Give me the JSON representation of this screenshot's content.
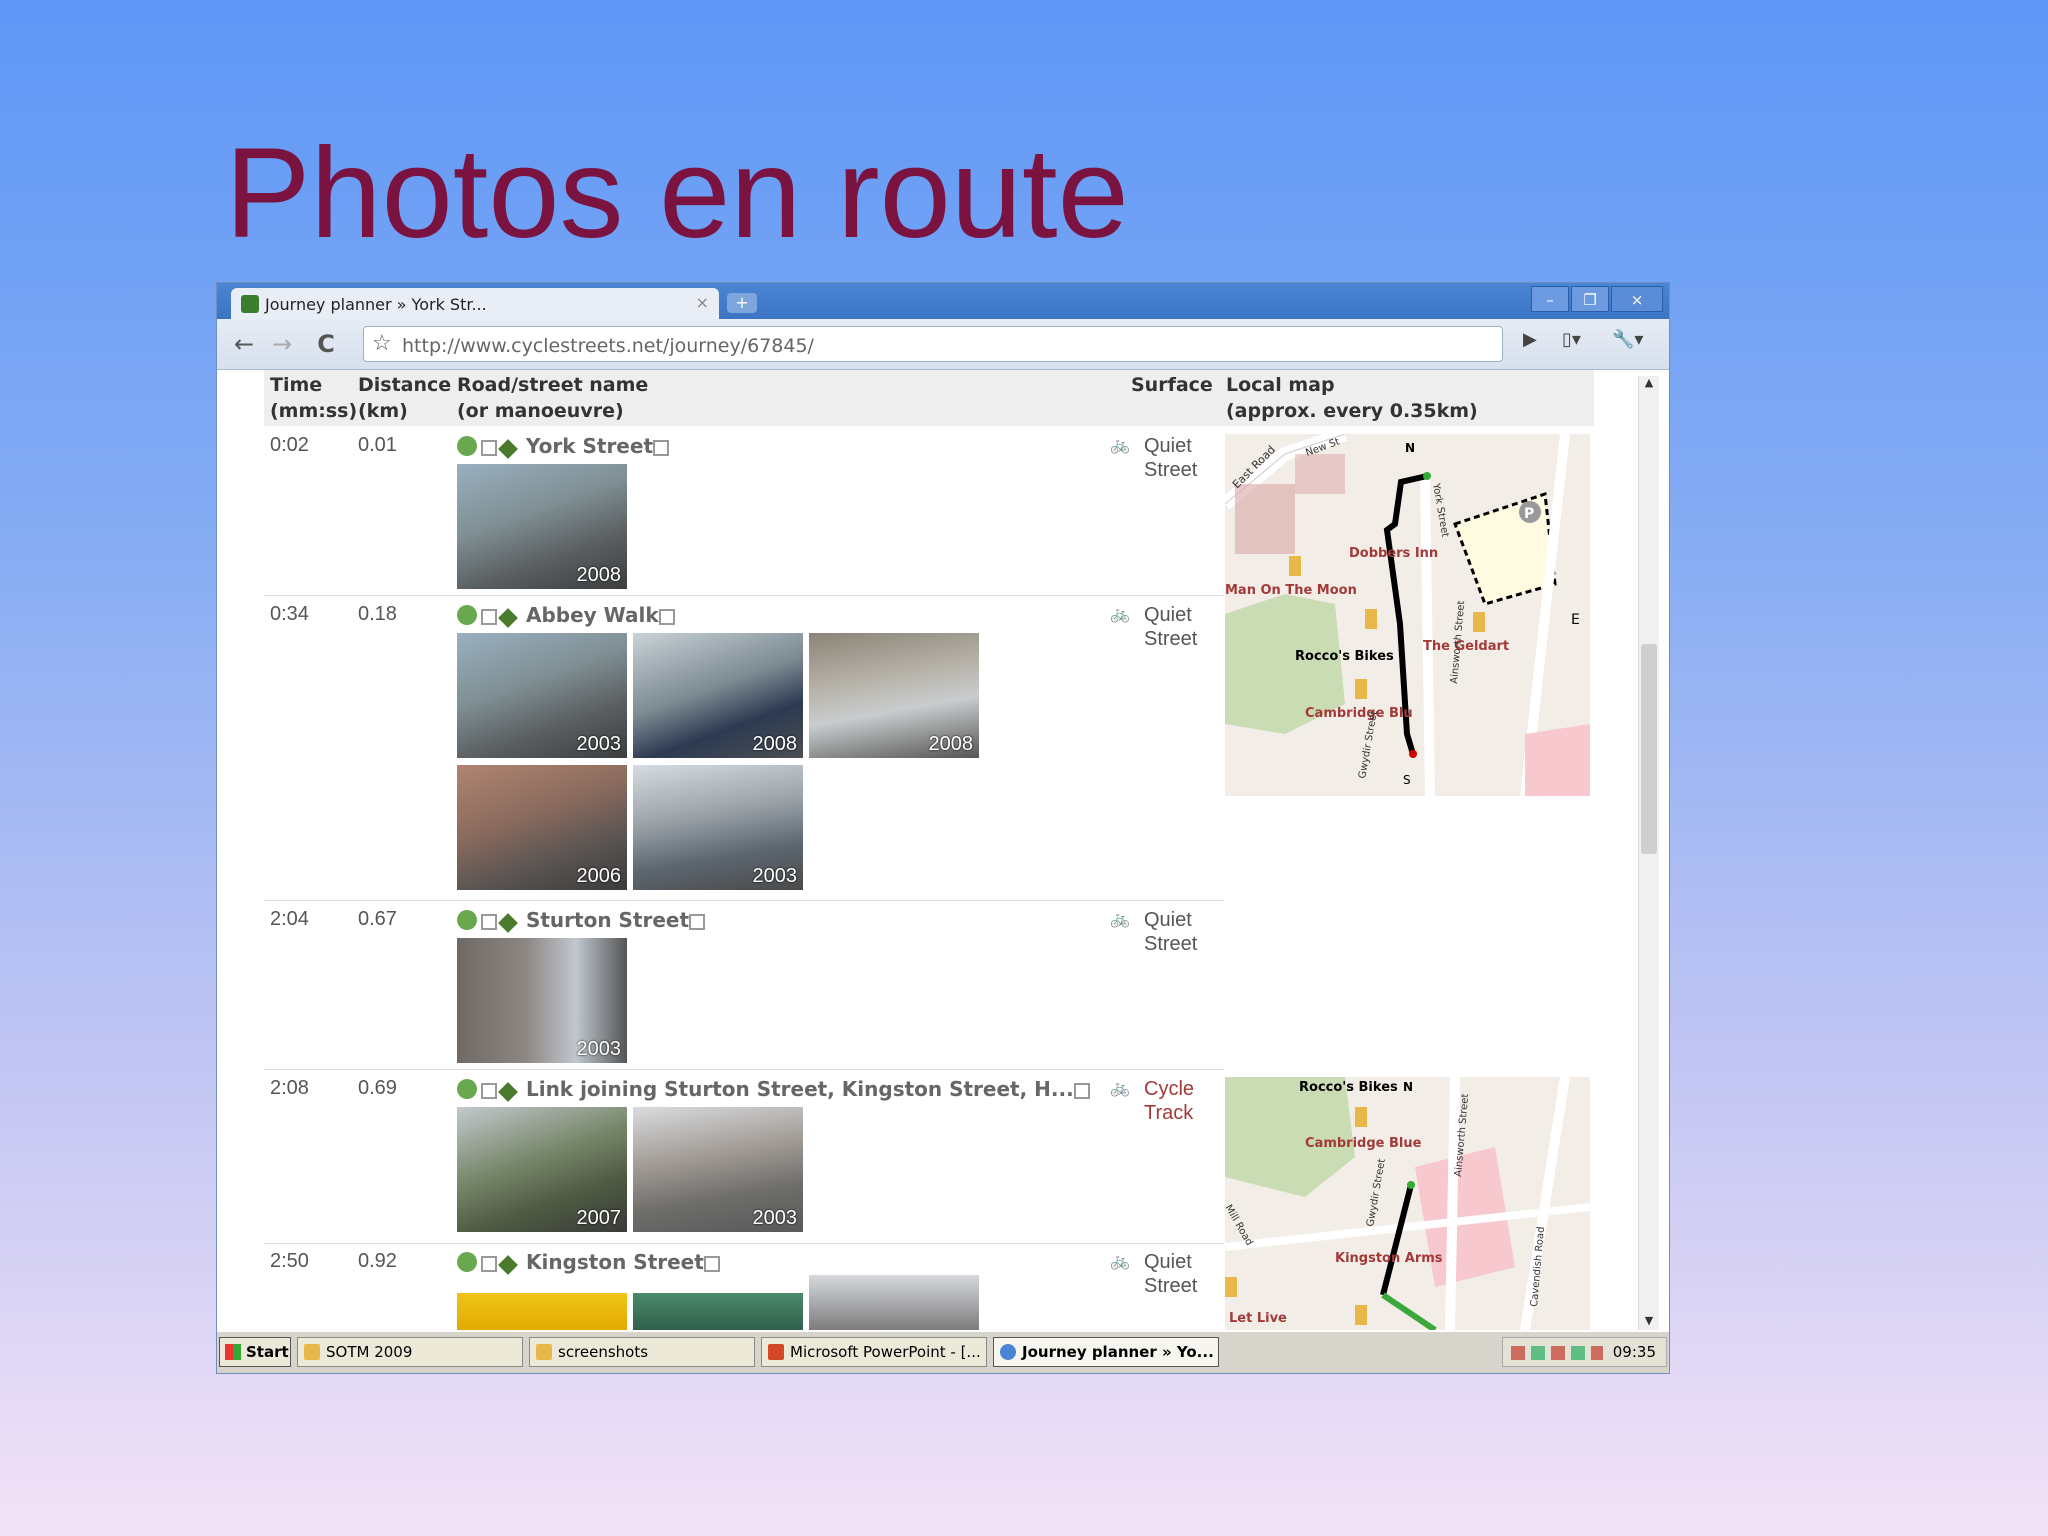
{
  "slide": {
    "title": "Photos en route"
  },
  "browser": {
    "tab_title": "Journey planner » York Str...",
    "tab_close": "×",
    "new_tab": "+",
    "window_buttons": {
      "minimize": "–",
      "restore": "❐",
      "close": "×"
    },
    "url": "http://www.cyclestreets.net/journey/67845/",
    "nav": {
      "back": "←",
      "forward": "→",
      "reload": "C",
      "star": "☆",
      "go": "▶",
      "page": "▯▾",
      "wrench": "🔧▾"
    }
  },
  "table": {
    "headers": {
      "time_line1": "Time",
      "time_line2": "(mm:ss)",
      "distance_line1": "Distance",
      "distance_line2": "(km)",
      "road_line1": "Road/street name",
      "road_line2": "(or manoeuvre)",
      "surface": "Surface",
      "map_line1": "Local map",
      "map_line2": "(approx. every 0.35km)"
    },
    "rows": [
      {
        "time": "0:02",
        "distance": "0.01",
        "road": "York Street",
        "surface_line1": "Quiet",
        "surface_line2": "Street",
        "photos": [
          "2008"
        ]
      },
      {
        "time": "0:34",
        "distance": "0.18",
        "road": "Abbey Walk",
        "surface_line1": "Quiet",
        "surface_line2": "Street",
        "photos": [
          "2003",
          "2008",
          "2008",
          "2006",
          "2003"
        ]
      },
      {
        "time": "2:04",
        "distance": "0.67",
        "road": "Sturton Street",
        "surface_line1": "Quiet",
        "surface_line2": "Street",
        "photos": [
          "2003"
        ]
      },
      {
        "time": "2:08",
        "distance": "0.69",
        "road": "Link joining Sturton Street, Kingston Street, H...",
        "surface_line1": "Cycle",
        "surface_line2": "Track",
        "photos": [
          "2007",
          "2003"
        ]
      },
      {
        "time": "2:50",
        "distance": "0.92",
        "road": "Kingston Street",
        "surface_line1": "Quiet",
        "surface_line2": "Street",
        "photos": [
          "",
          "",
          ""
        ]
      }
    ]
  },
  "maps": {
    "map1_labels": [
      "East Road",
      "New St",
      "N",
      "York Street",
      "Dobbers Inn",
      "Man On The Moon",
      "Rocco's Bikes",
      "The Geldart",
      "Cambridge Blu",
      "Ainsworth Street",
      "Gwydir Street",
      "E",
      "S",
      "P"
    ],
    "map2_labels": [
      "Rocco's Bikes",
      "N",
      "Cambridge Blue",
      "Gwydir Street",
      "Ainsworth Street",
      "Kingston Arms",
      "Let Live",
      "Cavendish Road",
      "Mill Road"
    ]
  },
  "taskbar": {
    "start": "Start",
    "tasks": [
      "SOTM 2009",
      "screenshots",
      "Microsoft PowerPoint - [...",
      "Journey planner » Yo..."
    ],
    "clock": "09:35"
  },
  "colors": {
    "title": "#7a1340",
    "cycle_track": "#a23a3a",
    "route": "#000000",
    "route_green": "#3aa83a"
  }
}
